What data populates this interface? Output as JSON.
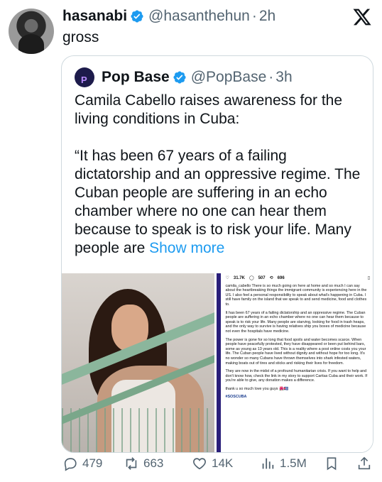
{
  "tweet": {
    "author_name": "hasanabi",
    "handle": "@hasanthehun",
    "dot": "·",
    "time": "2h",
    "text": "gross"
  },
  "quote": {
    "author_name": "Pop Base",
    "handle": "@PopBase",
    "dot": "·",
    "time": "3h",
    "paragraph1": "Camila Cabello raises awareness for the living conditions in Cuba:",
    "paragraph2": "“It has been 67 years of a failing dictatorship and an oppressive regime. The Cuban people are suffering in an echo chamber where no one can hear them because to speak is to risk your life. Many people are ",
    "show_more": "Show more"
  },
  "embedded_post": {
    "likes": "31.7K",
    "comments": "507",
    "shares": "696",
    "p1": "camila_cabello There is so much going on here at home and so much I can say about the heartbreaking things the immigrant community is experiencing here in the US. I also feel a personal responsibility to speak about what's happening in Cuba. I still have family on the island that we speak to and send medicine, food and clothes to.",
    "p2": "It has been 67 years of a failing dictatorship and an oppressive regime. The Cuban people are suffering in an echo chamber where no one can hear them because to speak is to risk your life. Many people are starving, looking for food in trash heaps, and the only way to survive is having relatives ship you boxes of medicine because not even the hospitals have medicine.",
    "p3": "The power is gone for so long that food spoils and water becomes scarce. When people have peacefully protested, they have disappeared or been put behind bars, some as young as 13 years old. This is a reality where a post online costs you your life. The Cuban people have lived without dignity and without hope for too long. It's no wonder so many Cubans have thrown themselves into shark infested waters, making boats out of tires and sticks and risking their lives for freedom.",
    "p4": "They are now in the midst of a profound humanitarian crisis. If you want to help and don't know how, check the link in my story to support Caritas Cuba and their work. If you're able to give, any donation makes a difference.",
    "p5": "thank u so much love you guys 🌺🇨🇺",
    "hashtag": "#SOSCUBA"
  },
  "actions": {
    "replies": "479",
    "reposts": "663",
    "likes": "14K",
    "views": "1.5M"
  },
  "colors": {
    "text": "#0f1419",
    "secondary": "#536471",
    "accent": "#1d9bf0",
    "border": "#cfd9de"
  },
  "icons": [
    "verified-badge-icon",
    "x-logo-icon",
    "reply-icon",
    "repost-icon",
    "like-icon",
    "views-icon",
    "bookmark-icon",
    "share-icon"
  ]
}
